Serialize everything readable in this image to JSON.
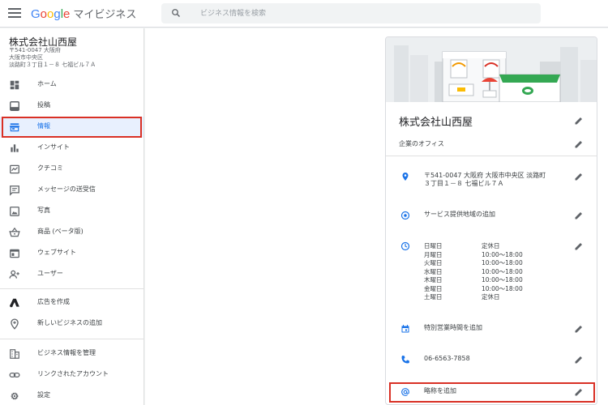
{
  "header": {
    "logo_letters": [
      "G",
      "o",
      "o",
      "g",
      "l",
      "e"
    ],
    "product": "マイビジネス",
    "search_placeholder": "ビジネス情報を検索"
  },
  "business": {
    "name": "株式会社山西屋",
    "address_lines": [
      "〒541-0047 大阪府",
      "大阪市中央区",
      "淡路町３丁目１－８ 七福ビル７Ａ"
    ]
  },
  "sidebar": {
    "items": [
      {
        "label": "ホーム",
        "icon": "dashboard-icon"
      },
      {
        "label": "投稿",
        "icon": "post-icon"
      },
      {
        "label": "情報",
        "icon": "storefront-icon"
      },
      {
        "label": "インサイト",
        "icon": "bar-chart-icon"
      },
      {
        "label": "クチコミ",
        "icon": "review-icon"
      },
      {
        "label": "メッセージの送受信",
        "icon": "message-icon"
      },
      {
        "label": "写真",
        "icon": "photo-icon"
      },
      {
        "label": "商品 (ベータ版)",
        "icon": "basket-icon"
      },
      {
        "label": "ウェブサイト",
        "icon": "website-icon"
      },
      {
        "label": "ユーザー",
        "icon": "add-user-icon"
      },
      {
        "label": "広告を作成",
        "icon": "ads-icon"
      },
      {
        "label": "新しいビジネスの追加",
        "icon": "add-location-icon"
      },
      {
        "label": "ビジネス情報を管理",
        "icon": "building-icon"
      },
      {
        "label": "リンクされたアカウント",
        "icon": "link-icon"
      },
      {
        "label": "設定",
        "icon": "gear-icon"
      }
    ],
    "active_index": 2
  },
  "info": {
    "name": "株式会社山西屋",
    "category": "企業のオフィス",
    "address_lines": [
      "〒541-0047 大阪府 大阪市中央区 淡路町",
      "３丁目１－８ 七福ビル７Ａ"
    ],
    "service_area": "サービス提供地域の追加",
    "hours": [
      {
        "day": "日曜日",
        "time": "定休日"
      },
      {
        "day": "月曜日",
        "time": "10:00～18:00"
      },
      {
        "day": "火曜日",
        "time": "10:00～18:00"
      },
      {
        "day": "水曜日",
        "time": "10:00～18:00"
      },
      {
        "day": "木曜日",
        "time": "10:00～18:00"
      },
      {
        "day": "金曜日",
        "time": "10:00～18:00"
      },
      {
        "day": "土曜日",
        "time": "定休日"
      }
    ],
    "special_hours": "特別営業時間を追加",
    "phone": "06-6563-7858",
    "short_name": "略称を追加"
  },
  "colors": {
    "accent": "#1a73e8",
    "highlight": "#d93025",
    "icon": "#5f6368",
    "active_bg": "#e8f0fe"
  }
}
